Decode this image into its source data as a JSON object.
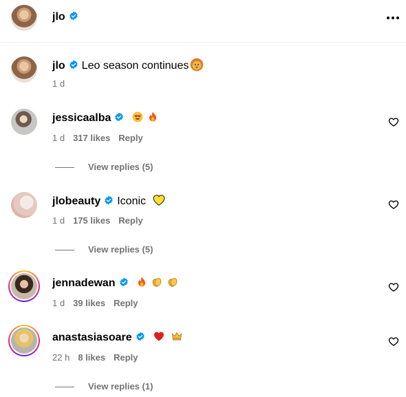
{
  "header": {
    "username": "jlo"
  },
  "caption": {
    "username": "jlo",
    "text": "Leo season continues",
    "time": "1 d"
  },
  "comments": [
    {
      "username": "jessicaalba",
      "text": "",
      "emojis": [
        "heart-eyes-emoji",
        "fire-emoji"
      ],
      "time": "1 d",
      "likes": "317 likes",
      "reply": "Reply",
      "view_replies": "View replies (5)"
    },
    {
      "username": "jlobeauty",
      "text": "Iconic",
      "emojis": [
        "yellow-heart-emoji"
      ],
      "time": "1 d",
      "likes": "175 likes",
      "reply": "Reply",
      "view_replies": "View replies (5)"
    },
    {
      "username": "jennadewan",
      "text": "",
      "emojis": [
        "fire-emoji",
        "clap-emoji",
        "clap-emoji"
      ],
      "time": "1 d",
      "likes": "39 likes",
      "reply": "Reply",
      "view_replies": ""
    },
    {
      "username": "anastasiasoare",
      "text": "",
      "emojis": [
        "red-heart-emoji",
        "crown-emoji"
      ],
      "time": "22 h",
      "likes": "8 likes",
      "reply": "Reply",
      "view_replies": "View replies (1)"
    }
  ],
  "colors": {
    "verified": "#0095f6",
    "muted": "#737373",
    "divider": "#efefef"
  }
}
